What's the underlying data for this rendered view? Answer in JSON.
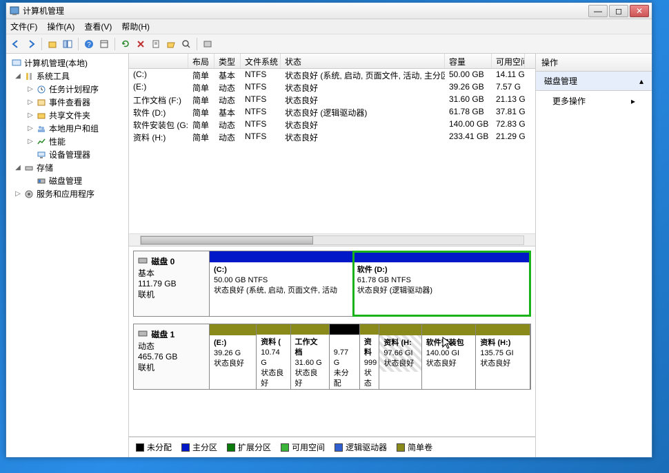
{
  "window": {
    "title": "计算机管理"
  },
  "menu": {
    "file": "文件(F)",
    "action": "操作(A)",
    "view": "查看(V)",
    "help": "帮助(H)"
  },
  "tree": {
    "root": "计算机管理(本地)",
    "sys": "系统工具",
    "sched": "任务计划程序",
    "event": "事件查看器",
    "shared": "共享文件夹",
    "users": "本地用户和组",
    "perf": "性能",
    "devmgr": "设备管理器",
    "storage": "存储",
    "diskmgmt": "磁盘管理",
    "services": "服务和应用程序"
  },
  "columns": {
    "vol": "",
    "layout": "布局",
    "type": "类型",
    "fs": "文件系统",
    "status": "状态",
    "cap": "容量",
    "free": "可用空间"
  },
  "vols": [
    {
      "n": "(C:)",
      "l": "简单",
      "t": "基本",
      "f": "NTFS",
      "s": "状态良好 (系统, 启动, 页面文件, 活动, 主分区)",
      "c": "50.00 GB",
      "fr": "14.11 G"
    },
    {
      "n": "(E:)",
      "l": "简单",
      "t": "动态",
      "f": "NTFS",
      "s": "状态良好",
      "c": "39.26 GB",
      "fr": "7.57 G"
    },
    {
      "n": "工作文档 (F:)",
      "l": "简单",
      "t": "动态",
      "f": "NTFS",
      "s": "状态良好",
      "c": "31.60 GB",
      "fr": "21.13 G"
    },
    {
      "n": "软件 (D:)",
      "l": "简单",
      "t": "基本",
      "f": "NTFS",
      "s": "状态良好 (逻辑驱动器)",
      "c": "61.78 GB",
      "fr": "37.81 G"
    },
    {
      "n": "软件安装包 (G:)",
      "l": "简单",
      "t": "动态",
      "f": "NTFS",
      "s": "状态良好",
      "c": "140.00 GB",
      "fr": "72.83 G"
    },
    {
      "n": "资料 (H:)",
      "l": "简单",
      "t": "动态",
      "f": "NTFS",
      "s": "状态良好",
      "c": "233.41 GB",
      "fr": "21.29 G"
    }
  ],
  "disk0": {
    "title": "磁盘 0",
    "type": "基本",
    "size": "111.79 GB",
    "online": "联机",
    "p1name": "(C:)",
    "p1size": "50.00 GB NTFS",
    "p1stat": "状态良好 (系统, 启动, 页面文件, 活动",
    "p2name": "软件  (D:)",
    "p2size": "61.78 GB NTFS",
    "p2stat": "状态良好 (逻辑驱动器)"
  },
  "disk1": {
    "title": "磁盘 1",
    "type": "动态",
    "size": "465.76 GB",
    "online": "联机",
    "a": {
      "n": "(E:)",
      "s": "39.26 G",
      "st": "状态良好"
    },
    "b": {
      "n": "资料  (",
      "s": "10.74 G",
      "st": "状态良好"
    },
    "c": {
      "n": "工作文档",
      "s": "31.60 G",
      "st": "状态良好"
    },
    "d": {
      "n": "",
      "s": "9.77 G",
      "st": "未分配"
    },
    "e": {
      "n": "资料",
      "s": "999",
      "st": "状态"
    },
    "f": {
      "n": "资料 (H:",
      "s": "97.66 GI",
      "st": "状态良好"
    },
    "g": {
      "n": "软件安装包",
      "s": "140.00 GI",
      "st": "状态良好"
    },
    "h": {
      "n": "资料  (H:)",
      "s": "135.75 GI",
      "st": "状态良好"
    }
  },
  "legend": {
    "unalloc": "未分配",
    "primary": "主分区",
    "ext": "扩展分区",
    "free": "可用空间",
    "logical": "逻辑驱动器",
    "simple": "简单卷"
  },
  "actions": {
    "hdr": "操作",
    "diskmgmt": "磁盘管理",
    "more": "更多操作"
  }
}
